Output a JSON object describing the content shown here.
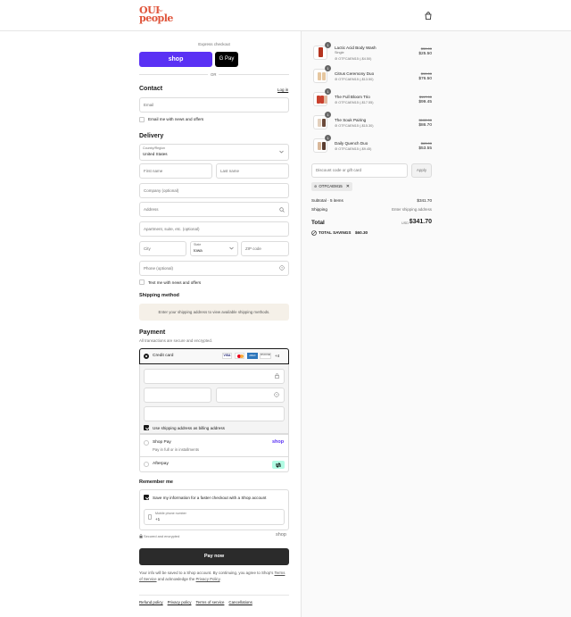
{
  "brand": {
    "line1": "OUI",
    "line2": "people",
    "small": "the"
  },
  "express": {
    "title": "Express checkout",
    "shop_label": "shop",
    "gpay_label": "G Pay",
    "or": "OR"
  },
  "contact": {
    "title": "Contact",
    "login": "Log in",
    "email_placeholder": "Email",
    "news": "Email me with news and offers"
  },
  "delivery": {
    "title": "Delivery",
    "country_label": "Country/Region",
    "country": "United States",
    "first": "First name",
    "last": "Last name",
    "company": "Company (optional)",
    "address": "Address",
    "apt": "Apartment, suite, etc. (optional)",
    "city": "City",
    "state_label": "State",
    "state": "Iowa",
    "zip": "ZIP code",
    "phone": "Phone (optional)",
    "text_news": "Text me with news and offers"
  },
  "shipping": {
    "title": "Shipping method",
    "message": "Enter your shipping address to view available shipping methods."
  },
  "payment": {
    "title": "Payment",
    "subtitle": "All transactions are secure and encrypted.",
    "credit": "Credit card",
    "cards": [
      "VISA",
      "MC",
      "AMEX",
      "DISCOVER"
    ],
    "more": "+4",
    "billing": "Use shipping address as billing address",
    "shoppay": "Shop Pay",
    "shoppay_sub": "Pay in full or in installments",
    "shoppay_logo": "shop",
    "afterpay": "Afterpay"
  },
  "remember": {
    "title": "Remember me",
    "save": "Save my information for a faster checkout with a Shop account",
    "mobile_label": "Mobile phone number",
    "mobile_value": "+1"
  },
  "secure": {
    "text": "Secured and encrypted",
    "shop": "shop"
  },
  "paynow": "Pay now",
  "terms": {
    "pre": "Your info will be saved to a Shop account. By continuing, you agree to Shop's",
    "tos": "Terms of Service",
    "mid": "and acknowledge the",
    "privacy": "Privacy Policy",
    "end": "."
  },
  "footer": [
    "Refund policy",
    "Privacy policy",
    "Terms of service",
    "Cancellations"
  ],
  "items": [
    {
      "qty": "1",
      "name": "Lactic Acid Body Wash",
      "variant": "Single",
      "discount": "OTFCAEM15 (-$4.50)",
      "was": "$30.00",
      "price": "$25.50",
      "color": "#b5341f"
    },
    {
      "qty": "1",
      "name": "Citrus Ceremony Duo",
      "variant": "",
      "discount": "OTFCAEM15 (-$13.50)",
      "was": "$90.00",
      "price": "$76.50",
      "color": "#e6c7a0"
    },
    {
      "qty": "1",
      "name": "The Full Bloom Trio",
      "variant": "",
      "discount": "OTFCAEM15 (-$17.55)",
      "was": "$117.00",
      "price": "$99.45",
      "color": "#c9402d"
    },
    {
      "qty": "1",
      "name": "The Souk Pairing",
      "variant": "",
      "discount": "OTFCAEM15 (-$15.30)",
      "was": "$102.00",
      "price": "$86.70",
      "color": "#e3d0bd"
    },
    {
      "qty": "1",
      "name": "Daily Quench Duo",
      "variant": "",
      "discount": "OTFCAEM15 (-$9.45)",
      "was": "$63.00",
      "price": "$53.55",
      "color": "#d9b89a"
    }
  ],
  "discount_code": {
    "placeholder": "Discount code or gift card",
    "apply": "Apply",
    "applied": "OTFCAEM15"
  },
  "summary": {
    "subtotal_label": "Subtotal · 5 items",
    "subtotal": "$341.70",
    "shipping_label": "Shipping",
    "shipping": "Enter shipping address",
    "total_label": "Total",
    "currency": "USD",
    "total": "$341.70",
    "savings_label": "TOTAL SAVINGS",
    "savings": "$60.30"
  }
}
